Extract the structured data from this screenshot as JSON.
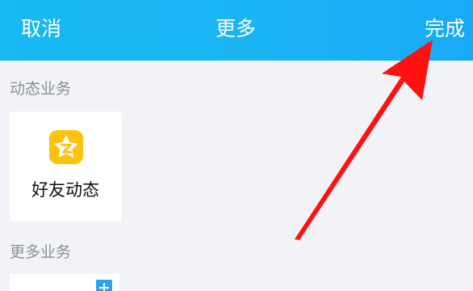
{
  "header": {
    "cancel_label": "取消",
    "title": "更多",
    "done_label": "完成"
  },
  "sections": {
    "dynamic_label": "动态业务",
    "more_label": "更多业务"
  },
  "dynamic_items": [
    {
      "label": "好友动态",
      "icon": "friend-feed-star-icon"
    }
  ],
  "colors": {
    "header_start": "#18b9f4",
    "header_end": "#19aaf6",
    "background": "#f2f3f7",
    "accent_red": "#ff1111",
    "icon_yellow": "#ffc20e"
  }
}
